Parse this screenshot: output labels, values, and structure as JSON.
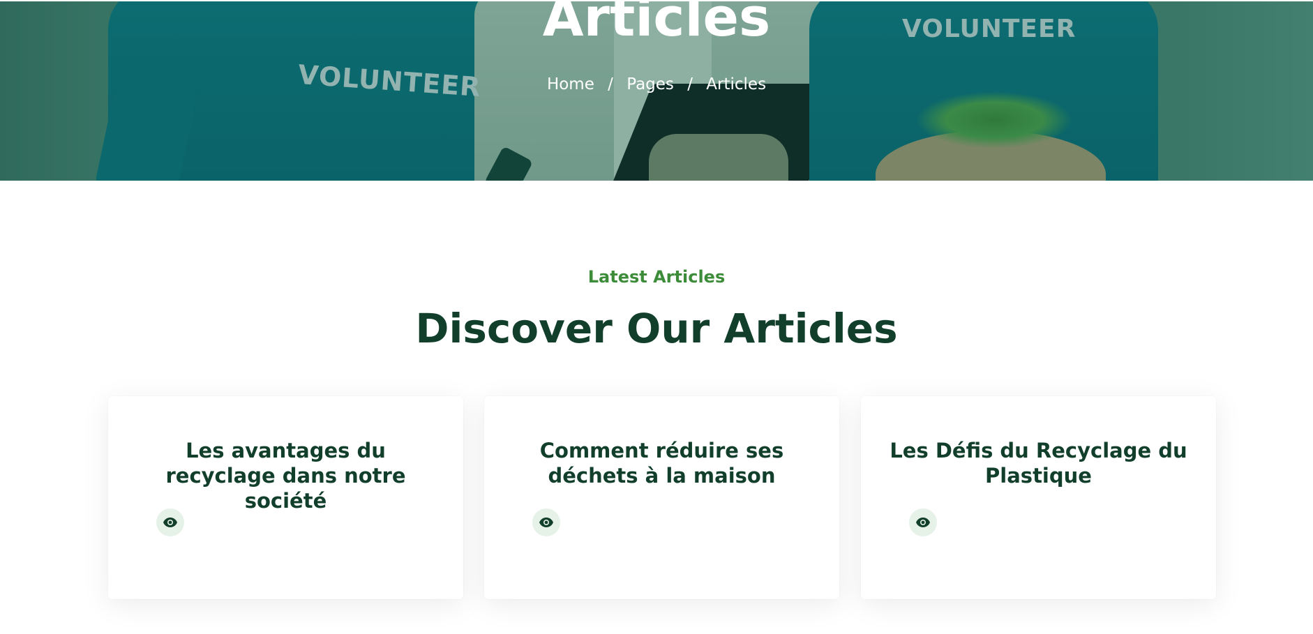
{
  "hero": {
    "title": "Articles",
    "shirt_text_left": "VOLUNTEER",
    "shirt_text_right": "VOLUNTEER",
    "breadcrumb": {
      "home": "Home",
      "pages": "Pages",
      "current": "Articles",
      "separator": "/"
    }
  },
  "section": {
    "eyebrow": "Latest Articles",
    "title": "Discover Our Articles"
  },
  "articles": [
    {
      "title": "Les avantages du recyclage dans notre société",
      "icon": "eye-icon"
    },
    {
      "title": "Comment réduire ses déchets à la maison",
      "icon": "eye-icon"
    },
    {
      "title": "Les Défis du Recyclage du Plastique",
      "icon": "eye-icon"
    }
  ],
  "colors": {
    "accent_green": "#3d8c3a",
    "dark_green": "#123f2c",
    "hero_overlay": "#357262",
    "icon_bg": "#e6f1e8"
  }
}
